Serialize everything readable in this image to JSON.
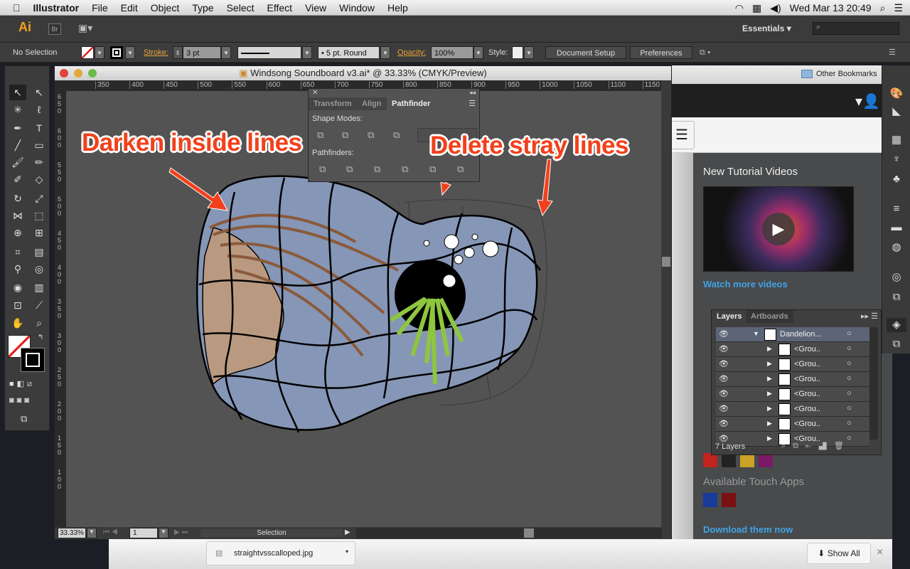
{
  "menubar": {
    "apple": "",
    "app": "Illustrator",
    "items": [
      "File",
      "Edit",
      "Object",
      "Type",
      "Select",
      "Effect",
      "View",
      "Window",
      "Help"
    ],
    "clock": "Wed Mar 13  20:49"
  },
  "appbar": {
    "logo": "Ai",
    "bridge": "Br",
    "workspace": "Essentials ▾"
  },
  "control": {
    "selection": "No Selection",
    "stroke_label": "Stroke:",
    "stroke_value": "3 pt",
    "profile": "Uniform",
    "brush": "5 pt. Round",
    "opacity_label": "Opacity:",
    "opacity_value": "100%",
    "style_label": "Style:",
    "document_setup": "Document Setup",
    "preferences": "Preferences"
  },
  "bookmarks": {
    "other": "Other Bookmarks"
  },
  "document": {
    "title": "Windsong Soundboard v3.ai* @ 33.33% (CMYK/Preview)",
    "hruler": [
      "350",
      "400",
      "450",
      "500",
      "550",
      "600",
      "650",
      "700",
      "750",
      "800",
      "850",
      "900",
      "950",
      "1000",
      "1050",
      "1100",
      "1150"
    ],
    "vruler": [
      "650",
      "600",
      "550",
      "500",
      "450",
      "400",
      "350",
      "300",
      "250",
      "200",
      "150",
      "100"
    ],
    "zoom": "33.33%",
    "artboard": "1",
    "status": "Selection"
  },
  "pathfinder": {
    "tabs": [
      "Transform",
      "Align",
      "Pathfinder"
    ],
    "shape_modes": "Shape Modes:",
    "pathfinders": "Pathfinders:"
  },
  "annotations": {
    "left": "Darken inside lines",
    "right": "Delete stray lines",
    "color": "#f2401b"
  },
  "cc_panel": {
    "tutorial_title": "New Tutorial Videos",
    "watch_more": "Watch more videos",
    "touch_apps": "Available Touch Apps",
    "download": "Download them now"
  },
  "layers": {
    "tabs": [
      "Layers",
      "Artboards"
    ],
    "rows": [
      "Dandelion...",
      "<Grou..",
      "<Grou..",
      "<Grou..",
      "<Grou..",
      "<Grou..",
      "<Grou..",
      "<Grou.."
    ],
    "count": "7 Layers"
  },
  "download_bar": {
    "file": "straightvsscalloped.jpg",
    "show_all": "Show All",
    "close": "×"
  }
}
